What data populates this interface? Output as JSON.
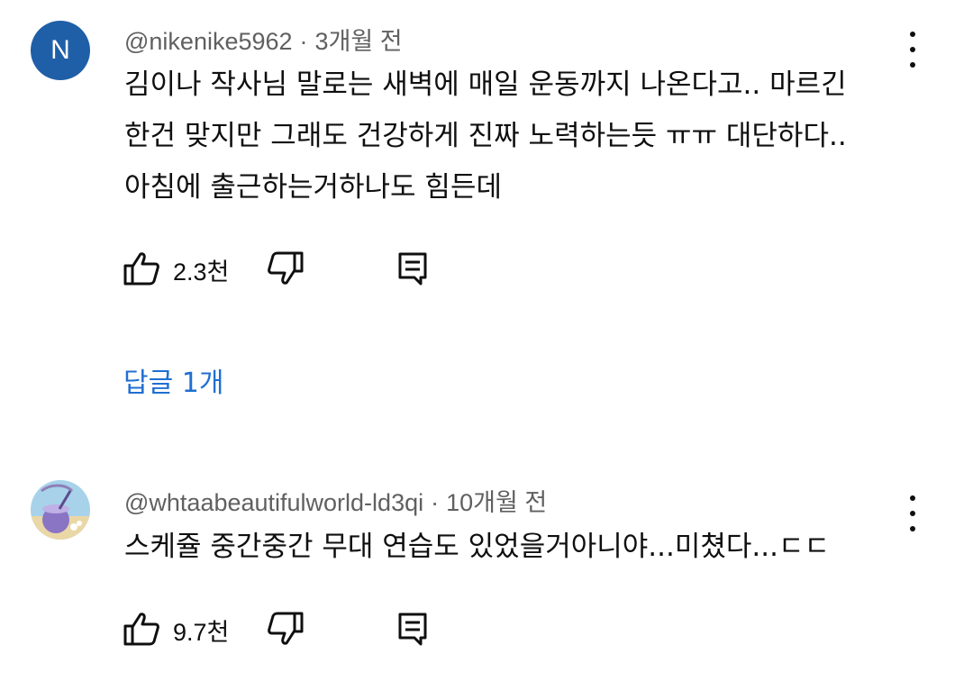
{
  "comments": [
    {
      "avatar_letter": "N",
      "avatar_color": "#1f5fa7",
      "handle": "@nikenike5962",
      "time": "3개월 전",
      "lines": [
        "김이나 작사님 말로는 새벽에 매일 운동까지 나온다고.. 마르긴",
        "한건 맞지만 그래도 건강하게 진짜 노력하는듯 ㅠㅠ 대단하다..",
        "아침에 출근하는거하나도 힘든데"
      ],
      "likes": "2.3천",
      "replies_label": "답글 1개"
    },
    {
      "avatar_icon": "coconut-drink-avatar-icon",
      "handle": "@whtaabeautifulworld-ld3qi",
      "time": "10개월 전",
      "lines": [
        "스케쥴 중간중간 무대 연습도 있었을거아니야...미쳤다...ㄷㄷ"
      ],
      "likes": "9.7천"
    }
  ],
  "separator": "·",
  "colors": {
    "reply_link": "#1f6fd1",
    "meta_text": "#606060"
  }
}
